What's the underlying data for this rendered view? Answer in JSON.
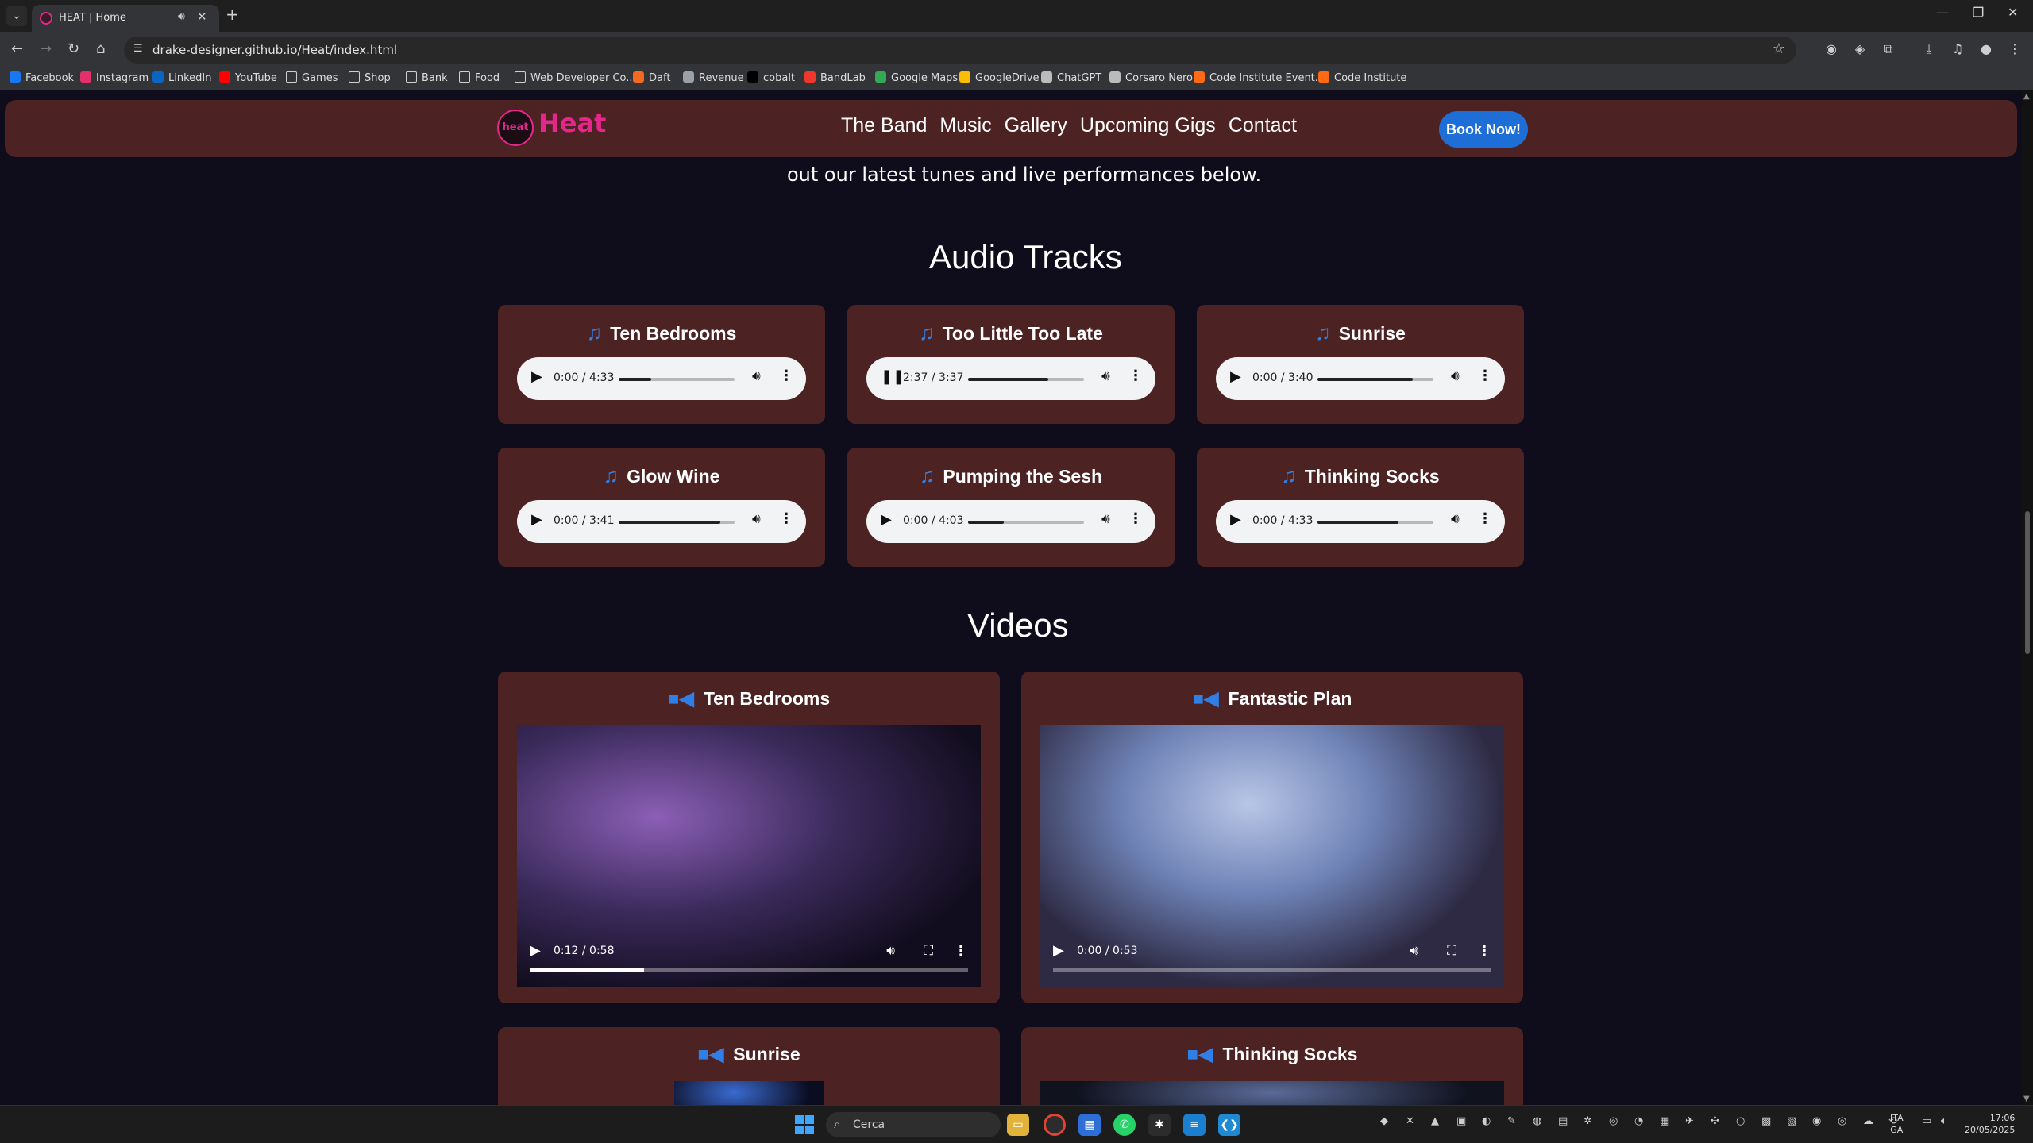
{
  "browser": {
    "tab_title": "HEAT | Home",
    "url": "drake-designer.github.io/Heat/index.html",
    "bookmarks": [
      {
        "label": "Facebook",
        "color": "#1877f2"
      },
      {
        "label": "Instagram",
        "color": "#e1306c"
      },
      {
        "label": "LinkedIn",
        "color": "#0a66c2"
      },
      {
        "label": "YouTube",
        "color": "#ff0000"
      },
      {
        "label": "Games",
        "color": "folder"
      },
      {
        "label": "Shop",
        "color": "folder"
      },
      {
        "label": "Bank",
        "color": "folder"
      },
      {
        "label": "Food",
        "color": "folder"
      },
      {
        "label": "Web Developer Co...",
        "color": "folder"
      },
      {
        "label": "Daft",
        "color": "#f26a21"
      },
      {
        "label": "Revenue",
        "color": "#9aa0a6"
      },
      {
        "label": "cobalt",
        "color": "#000000"
      },
      {
        "label": "BandLab",
        "color": "#f0372c"
      },
      {
        "label": "Google Maps",
        "color": "#34a853"
      },
      {
        "label": "GoogleDrive",
        "color": "#fbbc04"
      },
      {
        "label": "ChatGPT",
        "color": "#bbbbbb"
      },
      {
        "label": "Corsaro Nero",
        "color": "#bbbbbb"
      },
      {
        "label": "Code Institute Event...",
        "color": "#ff6a13"
      },
      {
        "label": "Code Institute",
        "color": "#ff6a13"
      }
    ]
  },
  "site": {
    "logo_badge": "heat",
    "logo_text": "Heat",
    "nav": [
      "The Band",
      "Music",
      "Gallery",
      "Upcoming Gigs",
      "Contact"
    ],
    "book_button": "Book Now!",
    "intro_text": "out our latest tunes and live performances below.",
    "accent_color": "#e5268b",
    "card_color": "#4c2222"
  },
  "audio": {
    "title": "Audio Tracks",
    "tracks": [
      {
        "name": "Ten Bedrooms",
        "time": "0:00 / 4:33",
        "progress": 0.28,
        "state": "paused"
      },
      {
        "name": "Too Little Too Late",
        "time": "2:37 / 3:37",
        "progress": 0.69,
        "state": "playing"
      },
      {
        "name": "Sunrise",
        "time": "0:00 / 3:40",
        "progress": 0.82,
        "state": "paused"
      },
      {
        "name": "Glow Wine",
        "time": "0:00 / 3:41",
        "progress": 0.88,
        "state": "paused"
      },
      {
        "name": "Pumping the Sesh",
        "time": "0:00 / 4:03",
        "progress": 0.31,
        "state": "paused"
      },
      {
        "name": "Thinking Socks",
        "time": "0:00 / 4:33",
        "progress": 0.7,
        "state": "paused"
      }
    ]
  },
  "videos": {
    "title": "Videos",
    "items": [
      {
        "name": "Ten Bedrooms",
        "time": "0:12 / 0:58",
        "progress": 0.26
      },
      {
        "name": "Fantastic Plan",
        "time": "0:00 / 0:53",
        "progress": 0.0
      },
      {
        "name": "Sunrise",
        "time": "",
        "progress": 0.0
      },
      {
        "name": "Thinking Socks",
        "time": "",
        "progress": 0.0
      }
    ]
  },
  "taskbar": {
    "search_placeholder": "Cerca",
    "lang_line1": "ITA",
    "lang_line2": "GA",
    "time": "17:06",
    "date": "20/05/2025"
  }
}
